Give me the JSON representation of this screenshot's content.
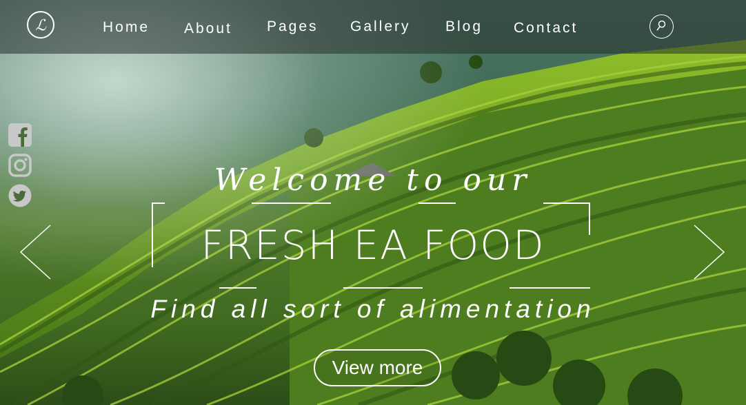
{
  "nav": {
    "logo_letter": "ℒ",
    "items": [
      {
        "label": "Home"
      },
      {
        "label": "About"
      },
      {
        "label": "Pages"
      },
      {
        "label": "Gallery"
      },
      {
        "label": "Blog"
      },
      {
        "label": "Contact"
      }
    ],
    "search_icon": "search-icon"
  },
  "social": {
    "icons": [
      "facebook-icon",
      "instagram-icon",
      "twitter-icon"
    ]
  },
  "hero": {
    "welcome": "Welcome to our",
    "headline": "FRESH EA FOOD",
    "tagline": "Find all sort of alimentation",
    "cta_label": "View more"
  },
  "slider": {
    "prev_icon": "chevron-left-icon",
    "next_icon": "chevron-right-icon"
  },
  "colors": {
    "text": "#ffffff",
    "navbar_overlay": "#28302c",
    "foliage": "#5a8a20"
  }
}
